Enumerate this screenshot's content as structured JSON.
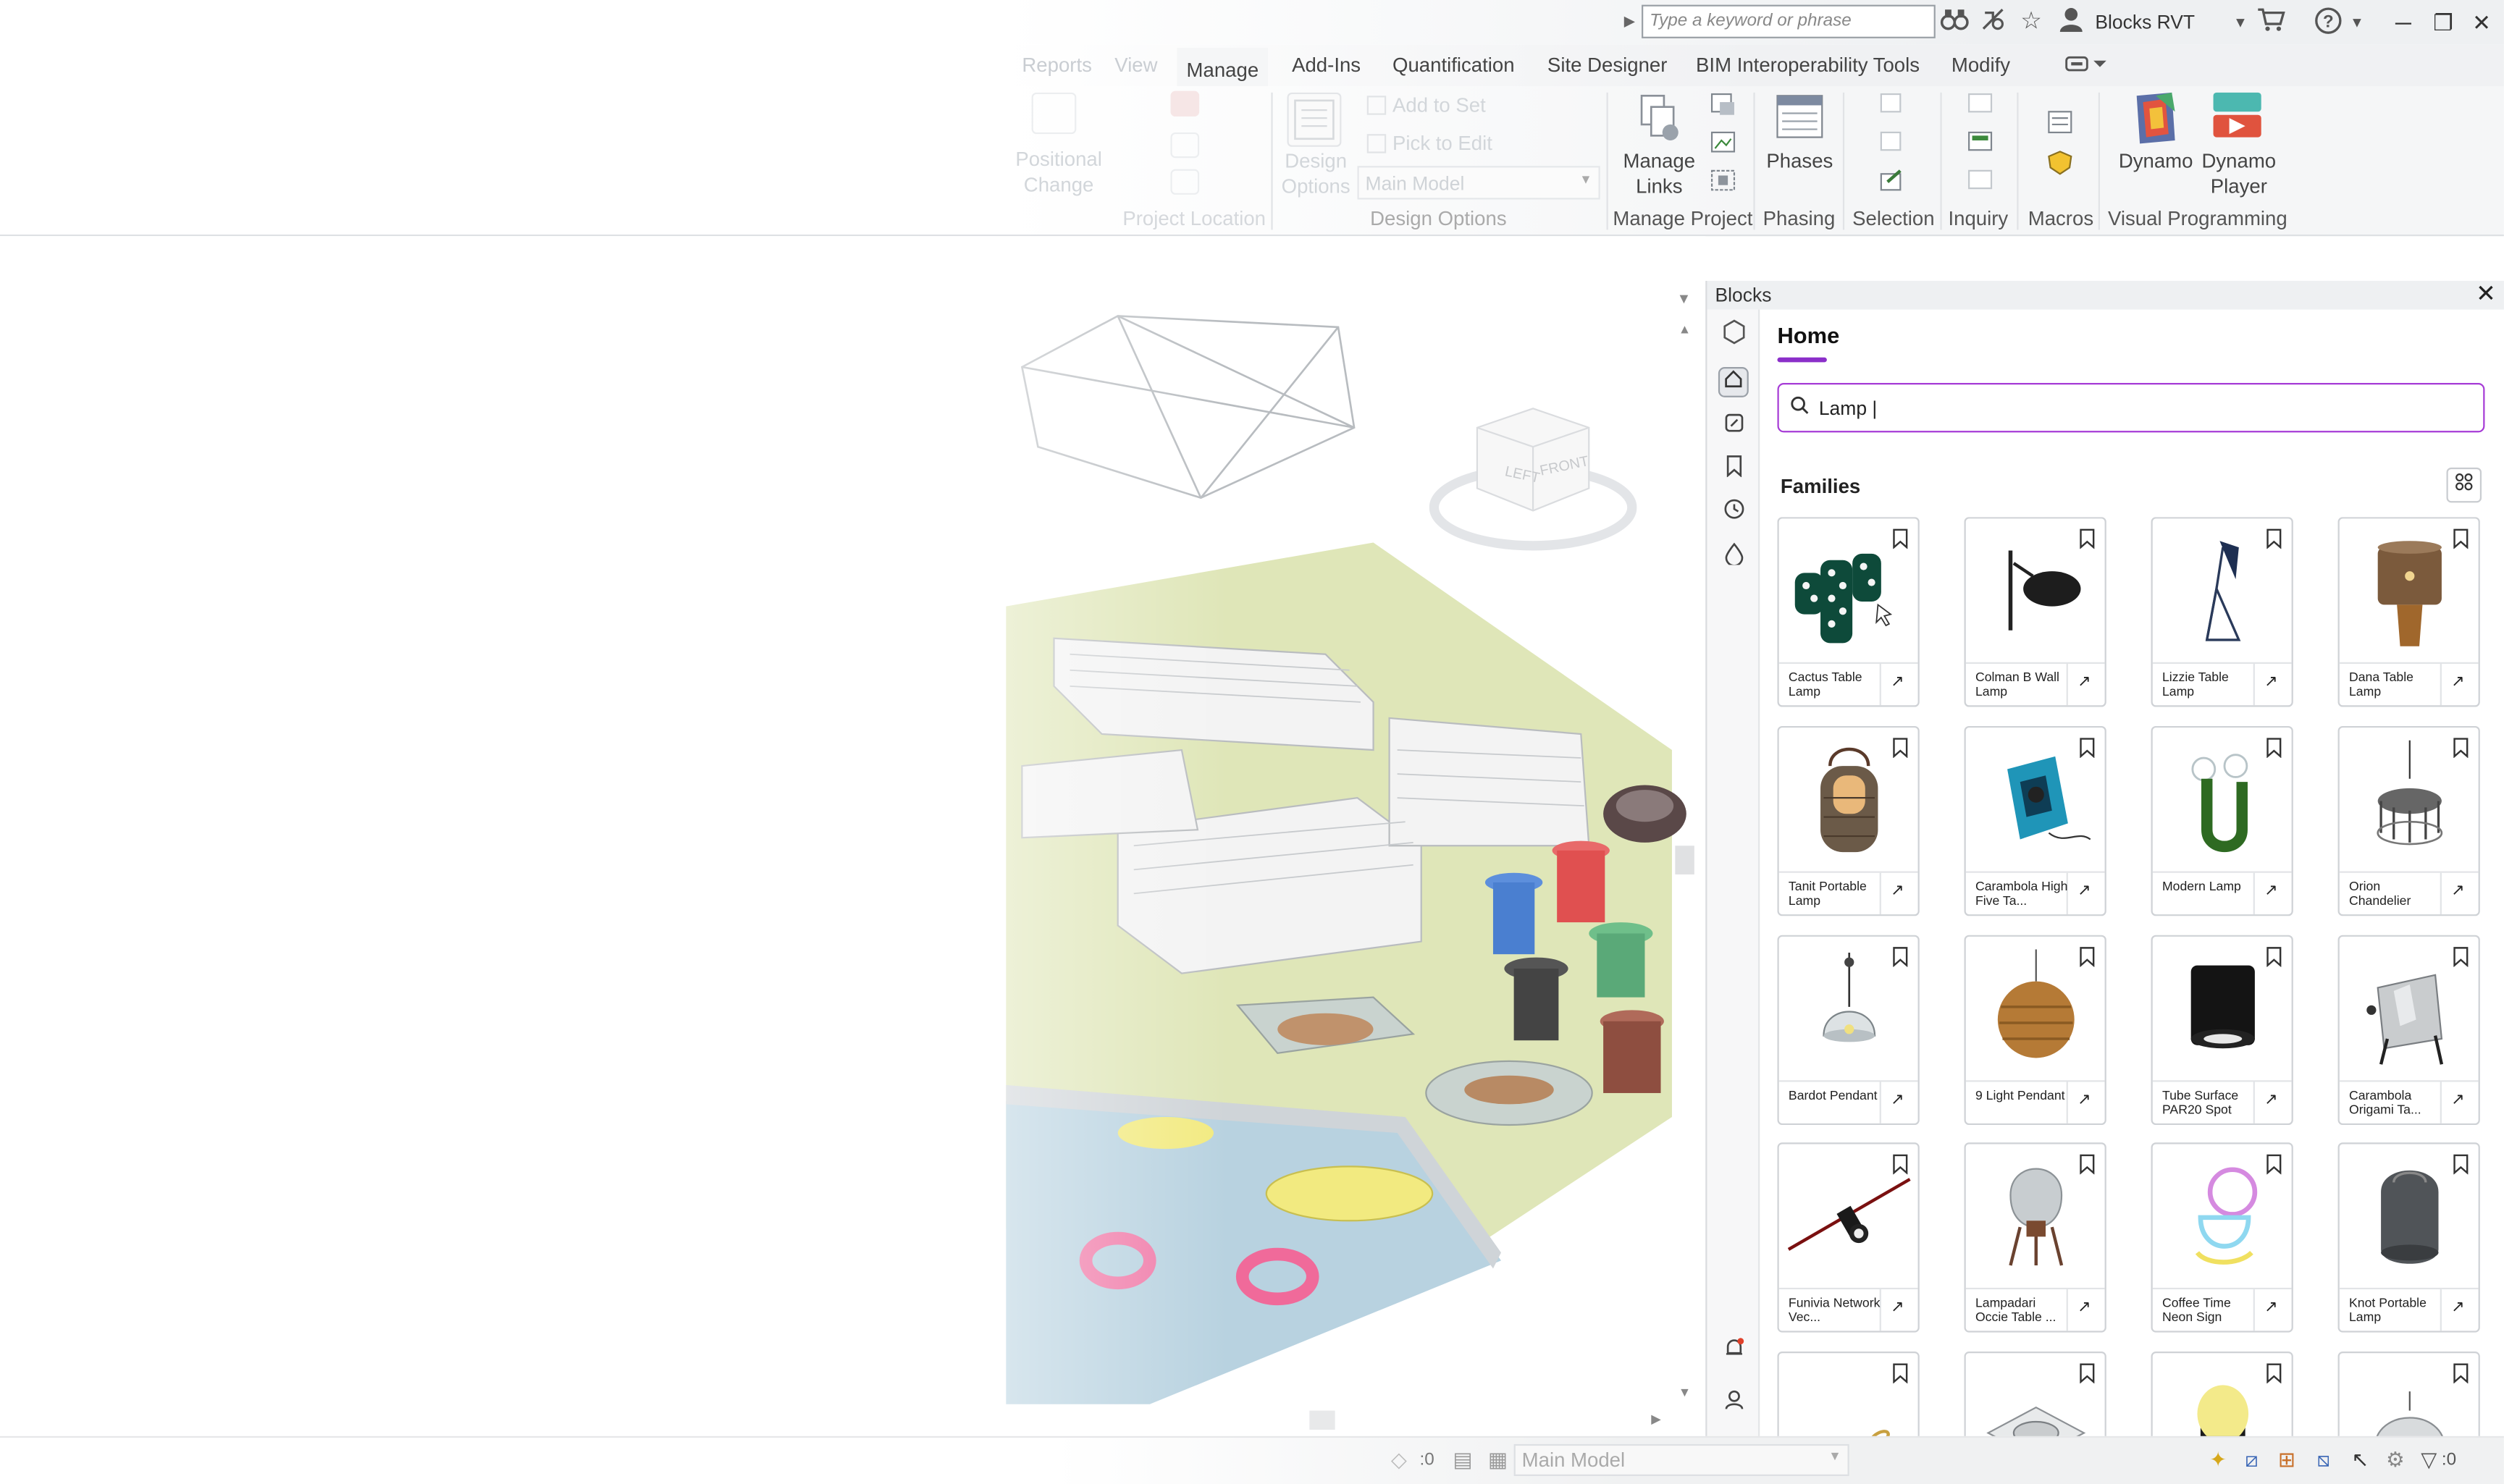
{
  "titlebar": {
    "search_placeholder": "Type a keyword or phrase",
    "user": "Blocks RVT"
  },
  "ribbon": {
    "tabs": [
      {
        "label": "Reports",
        "faded": true
      },
      {
        "label": "View",
        "faded": true
      },
      {
        "label": "Manage",
        "active": true
      },
      {
        "label": "Add-Ins"
      },
      {
        "label": "Quantification"
      },
      {
        "label": "Site Designer"
      },
      {
        "label": "BIM Interoperability Tools"
      },
      {
        "label": "Modify"
      }
    ],
    "buttons": {
      "add_to_set": "Add to Set",
      "pick_to_edit": "Pick to Edit",
      "design_options_1": "Design",
      "design_options_2": "Options",
      "main_model": "Main Model",
      "manage_links_1": "Manage",
      "manage_links_2": "Links",
      "phases": "Phases",
      "dynamo": "Dynamo",
      "dynamo_player_1": "Dynamo",
      "dynamo_player_2": "Player",
      "positional_1": "Positional",
      "positional_2": "Change"
    },
    "groups": {
      "project_location": "Project Location",
      "design_options": "Design Options",
      "manage_project": "Manage Project",
      "phasing": "Phasing",
      "selection": "Selection",
      "inquiry": "Inquiry",
      "macros": "Macros",
      "visual_programming": "Visual Programming"
    }
  },
  "viewcube": {
    "left": "LEFT",
    "front": "FRONT"
  },
  "panel": {
    "title": "Blocks",
    "home": "Home",
    "search_value": "Lamp |",
    "section": "Families",
    "cards": [
      {
        "name": "Cactus Table Lamp"
      },
      {
        "name": "Colman B Wall Lamp"
      },
      {
        "name": "Lizzie Table Lamp"
      },
      {
        "name": "Dana Table Lamp"
      },
      {
        "name": "Tanit Portable Lamp"
      },
      {
        "name": "Carambola High Five Ta..."
      },
      {
        "name": "Modern Lamp"
      },
      {
        "name": "Orion Chandelier"
      },
      {
        "name": "Bardot Pendant"
      },
      {
        "name": "9 Light Pendant"
      },
      {
        "name": "Tube Surface PAR20 Spot"
      },
      {
        "name": "Carambola Origami Ta..."
      },
      {
        "name": "Funivia Network Vec..."
      },
      {
        "name": "Lampadari Occie Table ..."
      },
      {
        "name": "Coffee Time Neon Sign"
      },
      {
        "name": "Knot Portable Lamp"
      },
      {
        "name": ""
      },
      {
        "name": ""
      },
      {
        "name": ""
      },
      {
        "name": ""
      }
    ]
  },
  "statusbar": {
    "model": "Main Model",
    "zero_left": ":0",
    "filter_count": ":0"
  }
}
